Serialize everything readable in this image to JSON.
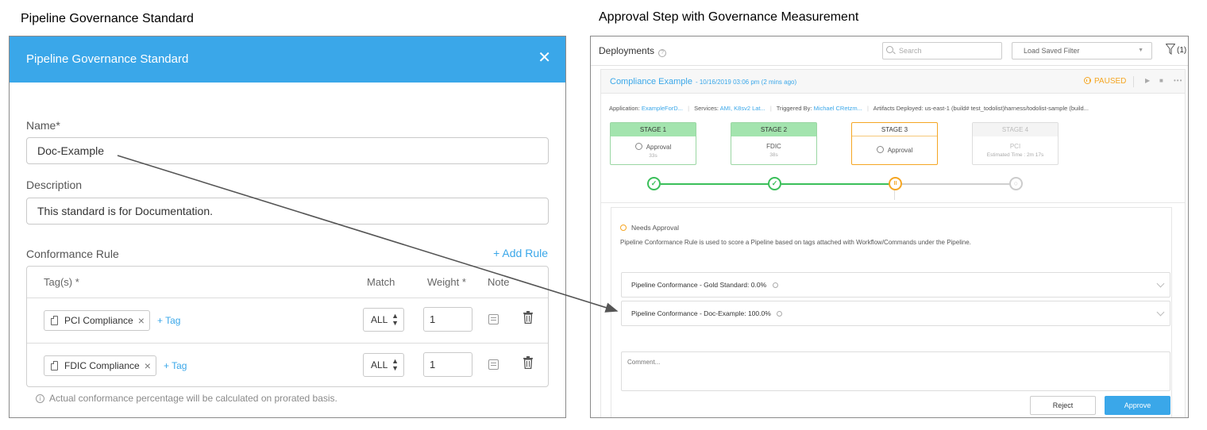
{
  "captions": {
    "left": "Pipeline Governance Standard",
    "right": "Approval Step with Governance Measurement"
  },
  "dialog": {
    "title": "Pipeline Governance Standard",
    "close_glyph": "✕",
    "name_label": "Name*",
    "name_value": "Doc-Example",
    "description_label": "Description",
    "description_value": "This standard is for Documentation.",
    "conformance_label": "Conformance Rule",
    "add_rule_label": "+ Add Rule",
    "table": {
      "headers": {
        "tags": "Tag(s) *",
        "match": "Match",
        "weight": "Weight *",
        "note": "Note"
      },
      "rows": [
        {
          "tag": "PCI Compliance",
          "add_tag": "+ Tag",
          "match": "ALL",
          "weight": "1"
        },
        {
          "tag": "FDIC Compliance",
          "add_tag": "+ Tag",
          "match": "ALL",
          "weight": "1"
        }
      ]
    },
    "footnote": "Actual conformance percentage will be calculated on prorated basis."
  },
  "deployments": {
    "title": "Deployments",
    "search_placeholder": "Search",
    "filter_label": "Load Saved Filter",
    "filter_count": "(1)",
    "card": {
      "title": "Compliance Example",
      "date": "- 10/16/2019 03:06 pm  (2 mins ago)",
      "status": "PAUSED",
      "meta": {
        "application_label": "Application:",
        "application_value": "ExampleForD...",
        "services_label": "Services:",
        "services_value": "AMI, K8sv2 Lat...",
        "triggered_label": "Triggered By:",
        "triggered_value": "Michael CRetzm...",
        "artifacts_label": "Artifacts Deployed:",
        "artifacts_value": "us-east-1 (build# test_todolist)harness/todolist-sample (build..."
      },
      "stages": [
        {
          "header": "STAGE 1",
          "name": "Approval",
          "sub": "33s",
          "state": "done"
        },
        {
          "header": "STAGE 2",
          "name": "FDIC",
          "sub": "38s",
          "state": "done"
        },
        {
          "header": "STAGE 3",
          "name": "Approval",
          "sub": "",
          "state": "active"
        },
        {
          "header": "STAGE 4",
          "name": "PCI",
          "sub": "Estimated Time : 2m 17s",
          "state": "pending"
        }
      ],
      "approval": {
        "needs_label": "Needs Approval",
        "description": "Pipeline Conformance Rule is used to score a Pipeline based on tags attached with Workflow/Commands under the Pipeline.",
        "scores": [
          {
            "label": "Pipeline Conformance - Gold Standard:",
            "value": "0.0%"
          },
          {
            "label": "Pipeline Conformance - Doc-Example:",
            "value": "100.0%"
          }
        ],
        "comment_placeholder": "Comment...",
        "reject_label": "Reject",
        "approve_label": "Approve"
      }
    }
  },
  "colors": {
    "accent": "#3aa7e9",
    "success": "#3bbf5a",
    "paused": "#f5a623"
  }
}
